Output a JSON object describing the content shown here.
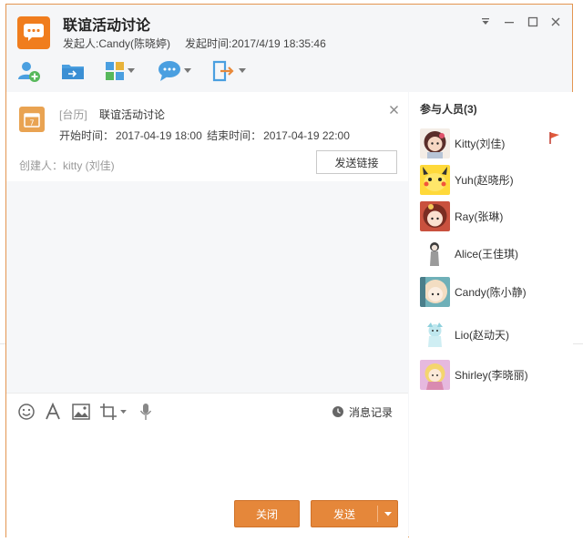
{
  "window": {
    "title": "联谊活动讨论",
    "initiator": "发起人:Candy(陈晓婷)",
    "start_time_label": "发起时间:2017/4/19 18:35:46",
    "accent": "#f07d1e"
  },
  "toolbar": {
    "items": [
      {
        "icon": "add-member-icon"
      },
      {
        "icon": "transfer-folder-icon"
      },
      {
        "icon": "apps-grid-icon"
      },
      {
        "icon": "chat-bubble-icon"
      },
      {
        "icon": "exit-icon"
      }
    ]
  },
  "event": {
    "tag": "[台历]",
    "name": "联谊活动讨论",
    "start_label": "开始时间：",
    "start_value": "2017-04-19 18:00",
    "end_label": "结束时间：",
    "end_value": "2017-04-19 22:00",
    "creator": "创建人：kitty (刘佳)",
    "send_link_label": "发送链接"
  },
  "input": {
    "history_label": "消息记录",
    "close_label": "关闭",
    "send_label": "发送"
  },
  "participants": {
    "header": "参与人员(3)",
    "items": [
      {
        "name": "Kitty(刘佳)"
      },
      {
        "name": "Yuh(赵晓彤)"
      },
      {
        "name": "Ray(张琳)"
      },
      {
        "name": "Alice(王佳琪)"
      },
      {
        "name": "Candy(陈小静)"
      },
      {
        "name": "Lio(赵动天)"
      },
      {
        "name": "Shirley(李晓丽)"
      }
    ]
  }
}
